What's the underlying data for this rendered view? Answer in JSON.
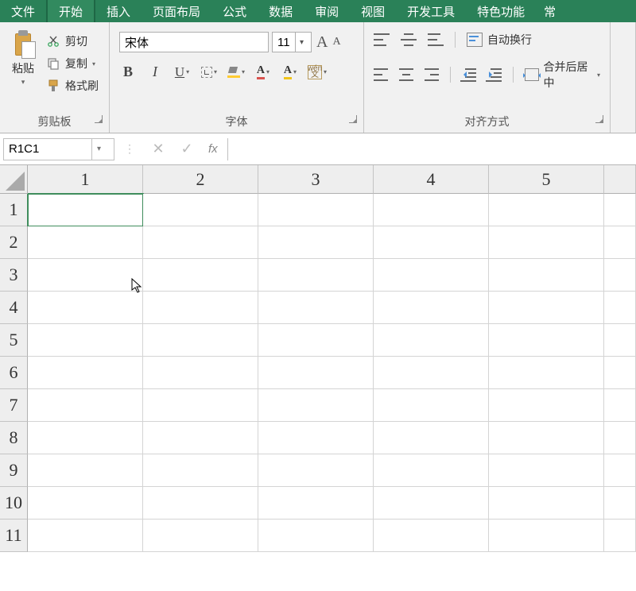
{
  "menu": {
    "items": [
      "文件",
      "开始",
      "插入",
      "页面布局",
      "公式",
      "数据",
      "审阅",
      "视图",
      "开发工具",
      "特色功能"
    ],
    "active_index": 1,
    "overflow": "常"
  },
  "clipboard": {
    "paste": "粘贴",
    "cut": "剪切",
    "copy": "复制",
    "format_painter": "格式刷",
    "group_label": "剪贴板"
  },
  "font": {
    "name": "宋体",
    "size": "11",
    "bold": "B",
    "italic": "I",
    "underline": "U",
    "bigA": "A",
    "smallA": "A",
    "phonetic_top": "wén",
    "phonetic_bottom": "文",
    "group_label": "字体"
  },
  "align": {
    "wrap": "自动换行",
    "merge": "合并后居中",
    "group_label": "对齐方式"
  },
  "formula_bar": {
    "name_box": "R1C1",
    "cancel": "✕",
    "confirm": "✓",
    "fx": "fx",
    "value": ""
  },
  "grid": {
    "columns": [
      "1",
      "2",
      "3",
      "4",
      "5"
    ],
    "rows": [
      "1",
      "2",
      "3",
      "4",
      "5",
      "6",
      "7",
      "8",
      "9",
      "10",
      "11"
    ],
    "selected": {
      "row": 0,
      "col": 0
    }
  }
}
